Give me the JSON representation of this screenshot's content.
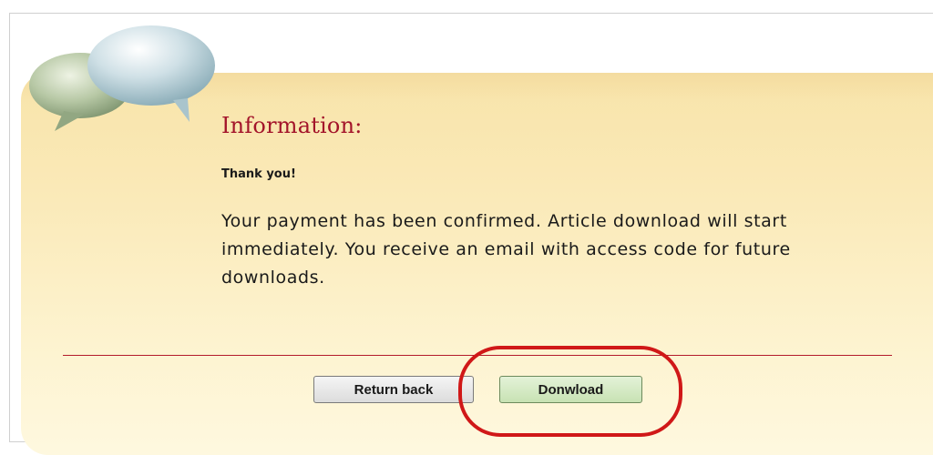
{
  "dialog": {
    "heading": "Information:",
    "thanks": "Thank you!",
    "message": "Your payment has been confirmed. Article download will start immediately. You receive an email with access code for future downloads.",
    "icon": "speech-bubbles-icon"
  },
  "actions": {
    "return_label": "Return back",
    "download_label": "Donwload"
  },
  "colors": {
    "heading": "#a3142a",
    "divider": "#b31b2c",
    "highlight": "#d01818",
    "panel": "#fae9b7",
    "download_button": "#d4e9c4"
  }
}
